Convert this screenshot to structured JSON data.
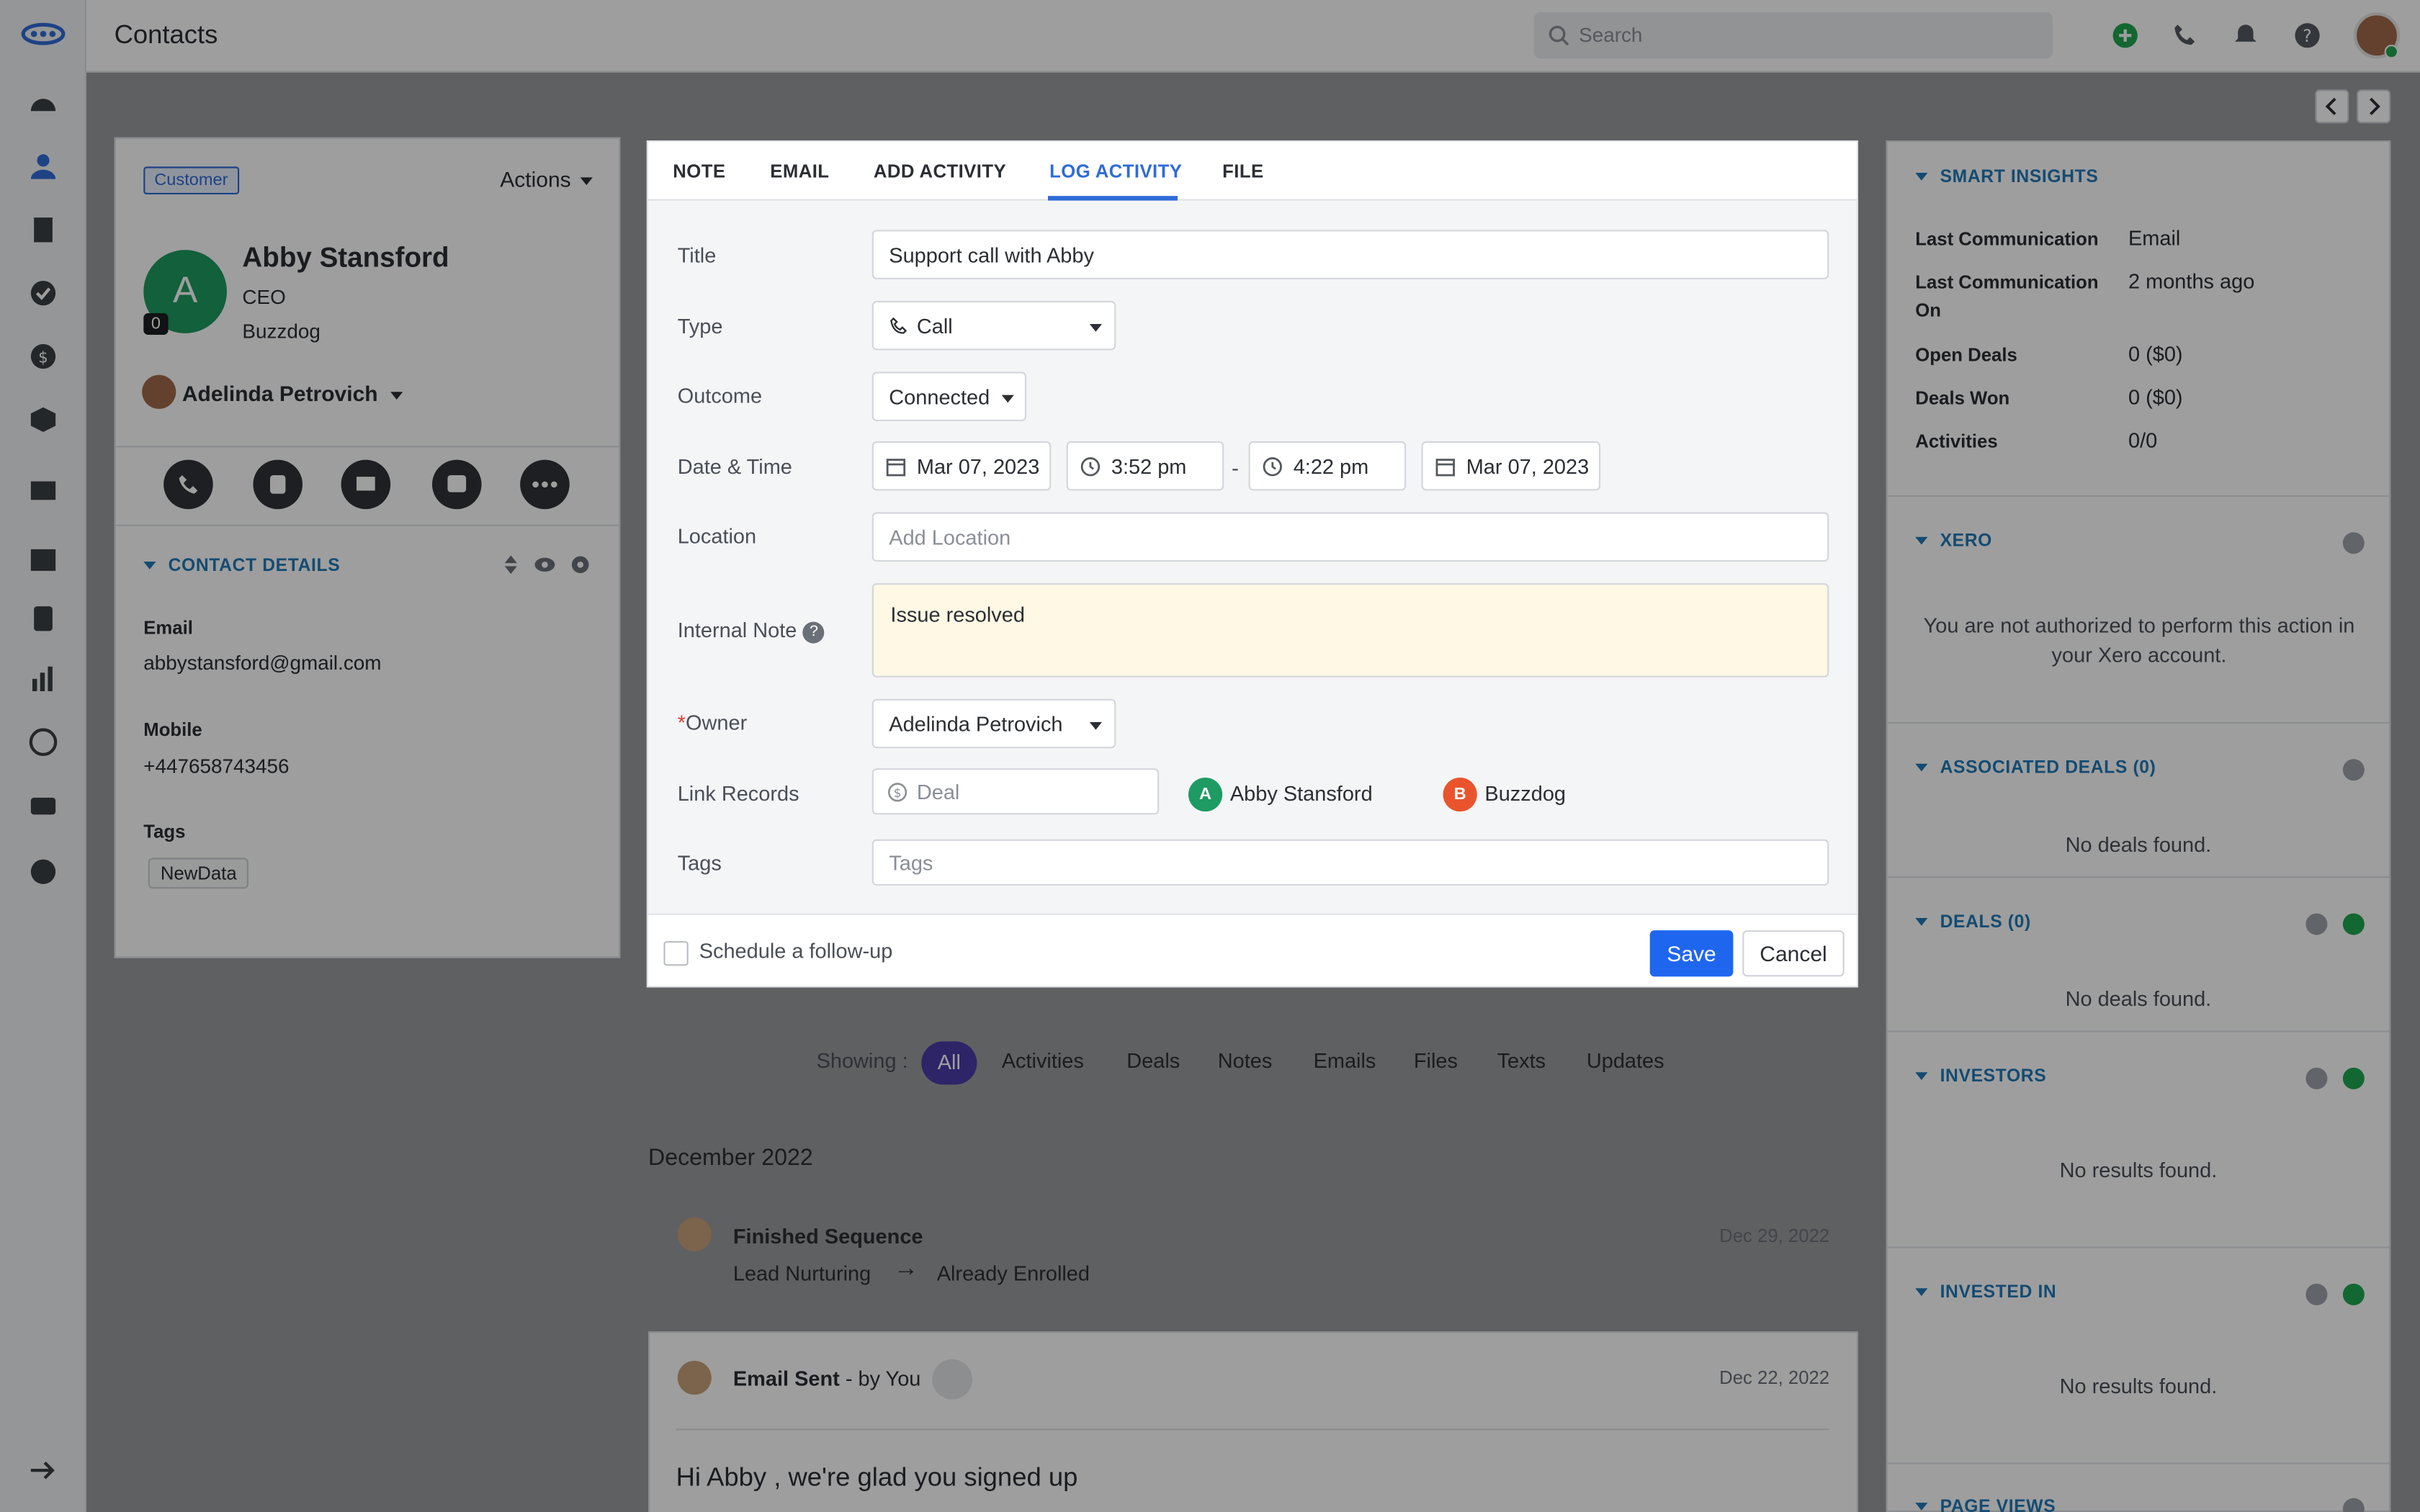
{
  "header": {
    "title": "Contacts",
    "search_placeholder": "Search"
  },
  "contact": {
    "badge": "Customer",
    "actions_label": "Actions",
    "avatar_letter": "A",
    "avatar_count": "0",
    "name": "Abby Stansford",
    "job_title": "CEO",
    "company": "Buzzdog",
    "owner": "Adelinda Petrovich",
    "details_heading": "CONTACT DETAILS",
    "email_label": "Email",
    "email": "abbystansford@gmail.com",
    "mobile_label": "Mobile",
    "mobile": "+447658743456",
    "tags_label": "Tags",
    "tag": "NewData"
  },
  "modal": {
    "tabs": [
      "NOTE",
      "EMAIL",
      "ADD ACTIVITY",
      "LOG ACTIVITY",
      "FILE"
    ],
    "active_tab": "LOG ACTIVITY",
    "title_label": "Title",
    "title_value": "Support call with Abby",
    "type_label": "Type",
    "type_value": "Call",
    "outcome_label": "Outcome",
    "outcome_value": "Connected",
    "datetime_label": "Date & Time",
    "start_date": "Mar 07, 2023",
    "start_time": "3:52 pm",
    "dash": "-",
    "end_time": "4:22 pm",
    "end_date": "Mar 07, 2023",
    "location_label": "Location",
    "location_placeholder": "Add Location",
    "note_label": "Internal Note",
    "note_value": "Issue resolved",
    "owner_star": "*",
    "owner_label": "Owner",
    "owner_value": "Adelinda Petrovich",
    "link_label": "Link Records",
    "deal_placeholder": "Deal",
    "linked": [
      {
        "letter": "A",
        "name": "Abby Stansford",
        "color": "#1e9b62"
      },
      {
        "letter": "B",
        "name": "Buzzdog",
        "color": "#e9542d"
      }
    ],
    "tags_label": "Tags",
    "tags_placeholder": "Tags",
    "followup_label": "Schedule a follow-up",
    "save_label": "Save",
    "cancel_label": "Cancel"
  },
  "feed": {
    "showing_label": "Showing :",
    "filters": [
      "All",
      "Activities",
      "Deals",
      "Notes",
      "Emails",
      "Files",
      "Texts",
      "Updates"
    ],
    "month": "December 2022",
    "item1_title": "Finished Sequence",
    "item1_from": "Lead Nurturing",
    "item1_arrow": "→",
    "item1_to": "Already Enrolled",
    "item1_date": "Dec 29, 2022",
    "item2_title": "Email Sent",
    "item2_by": " - by You",
    "item2_date": "Dec 22, 2022",
    "item2_subject": "Hi Abby , we're glad you signed up"
  },
  "insights": {
    "heading": "SMART INSIGHTS",
    "rows": [
      {
        "k": "Last Communication",
        "v": "Email"
      },
      {
        "k": "Last Communication On",
        "v": "2 months ago"
      },
      {
        "k": "Open Deals",
        "v": "0 ($0)"
      },
      {
        "k": "Deals Won",
        "v": "0 ($0)"
      },
      {
        "k": "Activities",
        "v": "0/0"
      }
    ],
    "xero_heading": "XERO",
    "xero_msg": "You are not authorized to perform this action in your Xero account.",
    "assoc_heading": "ASSOCIATED DEALS (0)",
    "assoc_empty": "No deals found.",
    "deals_heading": "DEALS (0)",
    "deals_empty": "No deals found.",
    "investors_heading": "INVESTORS",
    "investors_empty": "No results found.",
    "invested_heading": "INVESTED IN",
    "invested_empty": "No results found.",
    "pageviews_heading": "PAGE VIEWS"
  },
  "colors": {
    "accent": "#2f6bd8",
    "save": "#1f66ee",
    "pill": "#4b3ba8",
    "green": "#1e9b62"
  }
}
